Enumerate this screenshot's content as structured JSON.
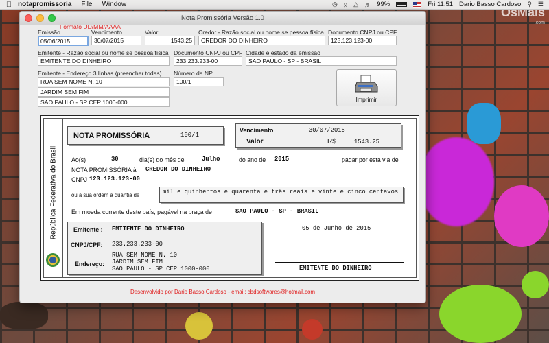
{
  "menubar": {
    "app_name": "notapromissoria",
    "menus": [
      "File",
      "Window"
    ],
    "battery": "99%",
    "clock": "Fri 11:51",
    "user": "Dario Basso Cardoso"
  },
  "watermark": {
    "brand": "OsMais",
    "domain": ".com"
  },
  "window": {
    "title": "Nota Promissória Versão 1.0"
  },
  "form": {
    "format_hint": "Formato DD/MM/AAAA",
    "emissao": {
      "label": "Emissão",
      "value": "05/06/2015"
    },
    "vencimento": {
      "label": "Vencimento",
      "value": "30/07/2015"
    },
    "valor": {
      "label": "Valor",
      "value": "1543.25"
    },
    "credor": {
      "label": "Credor - Razão social ou nome se pessoa física",
      "value": "CREDOR DO DINHEIRO"
    },
    "credor_doc": {
      "label": "Documento CNPJ ou CPF",
      "value": "123.123.123-00"
    },
    "emitente": {
      "label": "Emitente - Razão social ou nome se pessoa física",
      "value": "EMITENTE DO DINHEIRO"
    },
    "emitente_doc": {
      "label": "Documento CNPJ ou CPF",
      "value": "233.233.233-00"
    },
    "cidade": {
      "label": "Cidade e estado da emissão",
      "value": "SAO PAULO - SP - BRASIL"
    },
    "endereco": {
      "label": "Emitente - Endereço 3 linhas (preencher todas)",
      "line1": "RUA SEM NOME N. 10",
      "line2": "JARDIM SEM FIM",
      "line3": "SAO PAULO - SP CEP 1000-000"
    },
    "numero_np": {
      "label": "Número da NP",
      "value": "100/1"
    },
    "print_label": "Imprimir"
  },
  "note": {
    "side_text": "República Federativa do Brasil",
    "title": "NOTA PROMISSÓRIA",
    "number": "100/1",
    "vencimento_label": "Vencimento",
    "vencimento_value": "30/07/2015",
    "valor_label": "Valor",
    "currency": "R$",
    "valor_value": "1543.25",
    "aos_label": "Ao(s)",
    "day": "30",
    "dia_mes_label": "dia(s) do mês de",
    "month": "Julho",
    "ano_label": "do ano de",
    "year": "2015",
    "pagar_label": "pagar por esta via de",
    "np_a_label": "NOTA PROMISSÓRIA à",
    "credor": "CREDOR DO DINHEIRO",
    "cnpj_label": "CNPJ",
    "cnpj_value": "123.123.123-00",
    "ordem_label": "ou à sua ordem a quantia de",
    "extenso": "mil e quinhentos e quarenta e três reais e vinte e cinco centavos",
    "moeda_label": "Em moeda corrente deste país, pagável na praça de",
    "praca": "SAO PAULO - SP - BRASIL",
    "emitente_label": "Emitente :",
    "emitente_value": "EMITENTE DO DINHEIRO",
    "cpf_label": "CNPJ/CPF:",
    "cpf_value": "233.233.233-00",
    "endereco_label": "Endereço:",
    "end1": "RUA SEM NOME N. 10",
    "end2": "JARDIM SEM FIM",
    "end3": "SAO PAULO - SP CEP 1000-000",
    "data_emissao": "05 de Junho de 2015",
    "assinatura": "EMITENTE DO DINHEIRO"
  },
  "footer": "Desenvolvido por Dario Basso Cardoso - email: cbdsoftwares@hotmail.com"
}
